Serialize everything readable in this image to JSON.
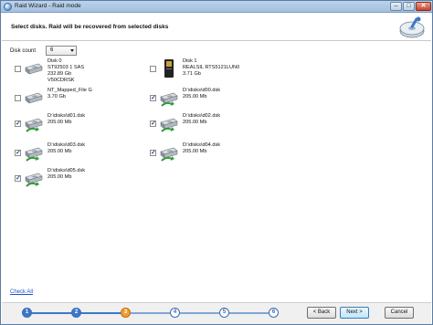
{
  "window": {
    "title": "Raid Wizard - Raid mode"
  },
  "header": {
    "instruction": "Select disks. Raid will be recovered from selected disks"
  },
  "disk_count": {
    "label": "Disk count",
    "value": "6"
  },
  "disks": [
    {
      "lines": [
        "Disk 0",
        "ST92503 1 SAS",
        "232.89 Gb",
        "V50CDRSK"
      ],
      "checked": false,
      "icon": "hard-disk-icon"
    },
    {
      "lines": [
        "Disk 1",
        "REALSIL RTS5121LUN0",
        "3.71 Gb"
      ],
      "checked": false,
      "icon": "card-reader-icon"
    },
    {
      "lines": [
        "NT_Mapped_File G",
        "3.70 Gb"
      ],
      "checked": false,
      "icon": "hard-disk-icon"
    },
    {
      "lines": [
        "D:\\disks\\d00.dsk",
        "205.00 Mb"
      ],
      "checked": true,
      "icon": "disk-image-icon"
    },
    {
      "lines": [
        "D:\\disks\\d01.dsk",
        "205.00 Mb"
      ],
      "checked": true,
      "icon": "disk-image-icon"
    },
    {
      "lines": [
        "D:\\disks\\d02.dsk",
        "205.00 Mb"
      ],
      "checked": true,
      "icon": "disk-image-icon"
    },
    {
      "lines": [
        "D:\\disks\\d03.dsk",
        "205.00 Mb"
      ],
      "checked": true,
      "icon": "disk-image-icon"
    },
    {
      "lines": [
        "D:\\disks\\d04.dsk",
        "205.00 Mb"
      ],
      "checked": true,
      "icon": "disk-image-icon"
    },
    {
      "lines": [
        "D:\\disks\\d05.dsk",
        "205.00 Mb"
      ],
      "checked": true,
      "icon": "disk-image-icon"
    }
  ],
  "check_all": "Check All",
  "steps": [
    "1",
    "2",
    "3",
    "4",
    "5",
    "6"
  ],
  "current_step": 3,
  "buttons": {
    "back": "< Back",
    "next": "Next >",
    "cancel": "Cancel"
  },
  "colors": {
    "step_done": "#3b78c9",
    "step_current": "#f39c30",
    "title_bar": "#a4c0df"
  }
}
